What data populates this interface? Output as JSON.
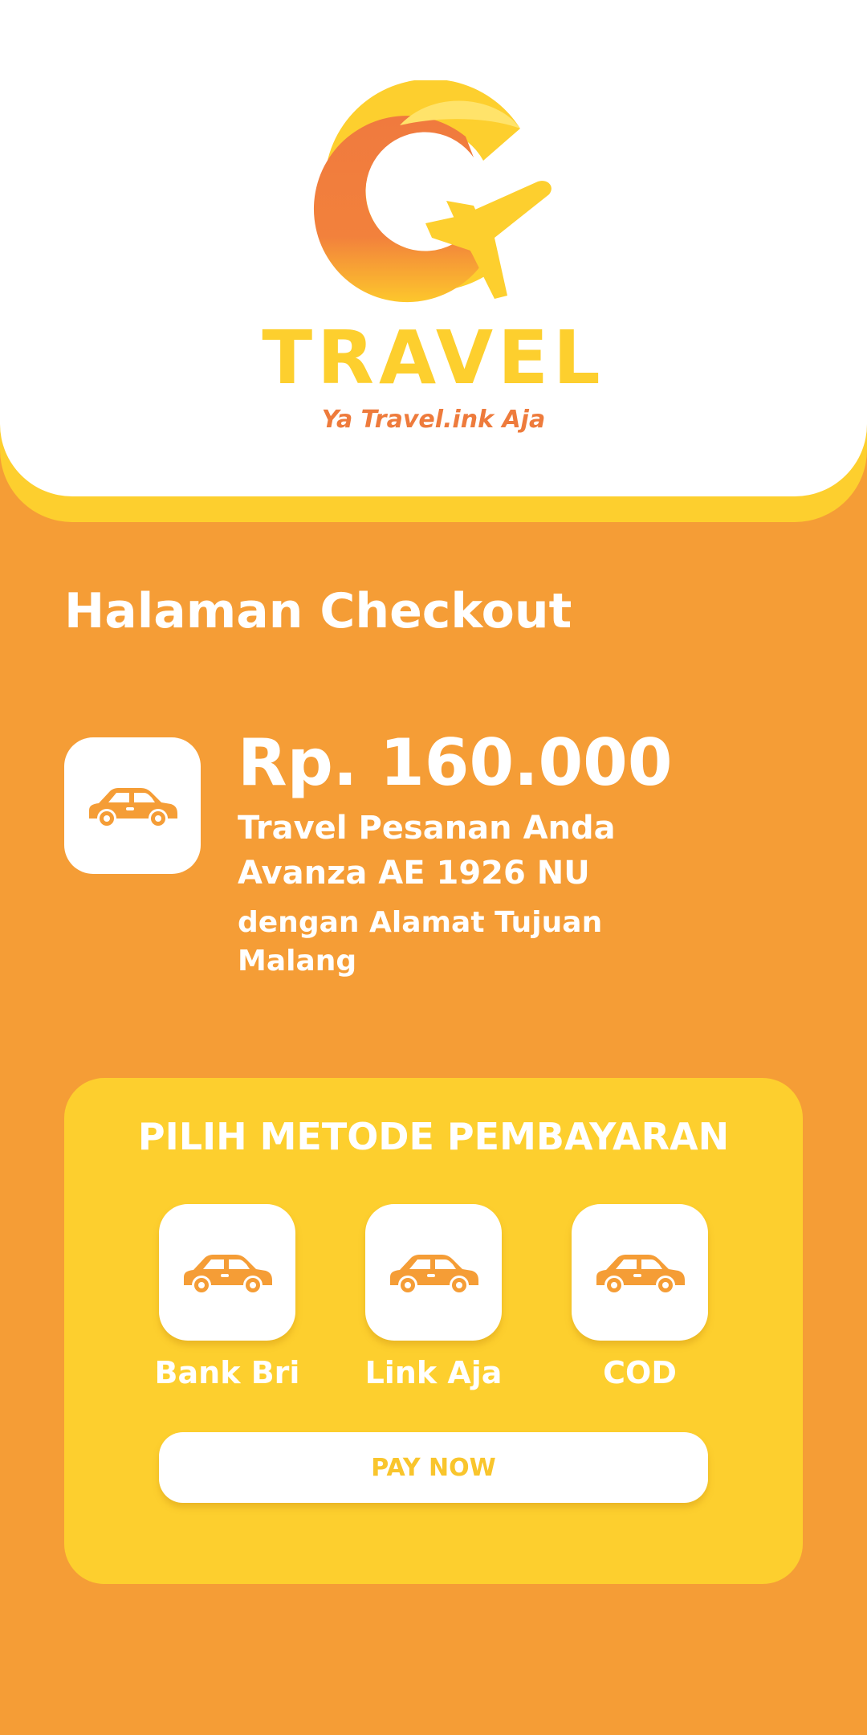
{
  "brand": {
    "name": "TRAVEL",
    "tagline": "Ya Travel.ink Aja",
    "logo_icon": "g-plane-logo",
    "colors": {
      "primary_orange": "#F59D36",
      "yellow": "#FDCF2E",
      "tagline_orange": "#EE7B3C",
      "white": "#FFFFFF"
    }
  },
  "page": {
    "title": "Halaman Checkout"
  },
  "order": {
    "icon": "car-icon",
    "price": "Rp. 160.000",
    "line1": "Travel Pesanan Anda",
    "line2": "Avanza AE 1926 NU",
    "line3": "dengan Alamat Tujuan",
    "line4": "Malang"
  },
  "payment": {
    "title": "PILIH METODE PEMBAYARAN",
    "methods": [
      {
        "label": "Bank Bri",
        "icon": "car-icon"
      },
      {
        "label": "Link Aja",
        "icon": "car-icon"
      },
      {
        "label": "COD",
        "icon": "car-icon"
      }
    ],
    "pay_button": "PAY NOW"
  }
}
